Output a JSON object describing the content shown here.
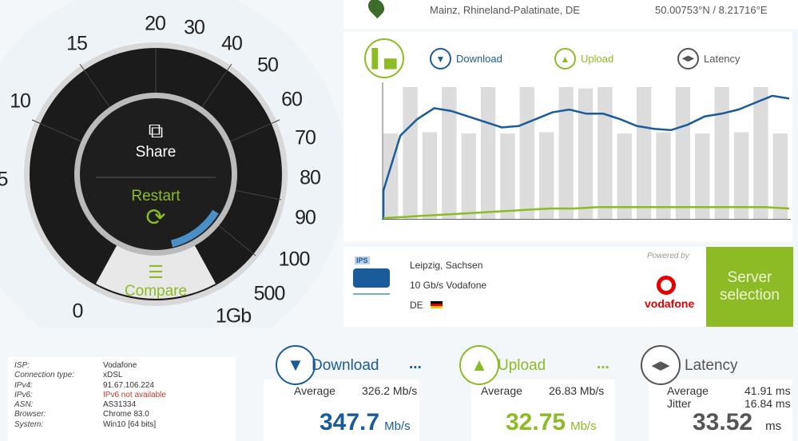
{
  "location": {
    "city": "Mainz, Rhineland-Palatinate, DE",
    "coords": "50.00753°N / 8.21716°E"
  },
  "gauge": {
    "labels": [
      "0",
      "5",
      "10",
      "15",
      "20",
      "30",
      "40",
      "50",
      "60",
      "70",
      "80",
      "90",
      "100",
      "500",
      "1Gb"
    ],
    "share": "Share",
    "restart": "Restart",
    "compare": "Compare",
    "progress_percent": 15
  },
  "legend": {
    "download": "Download",
    "upload": "Upload",
    "latency": "Latency"
  },
  "chart_data": {
    "type": "line",
    "series": [
      {
        "name": "Download",
        "values": [
          20,
          60,
          72,
          80,
          78,
          74,
          70,
          66,
          67,
          72,
          77,
          79,
          76,
          76,
          72,
          67,
          65,
          64,
          68,
          74,
          76,
          79,
          84,
          89,
          87
        ]
      },
      {
        "name": "Upload",
        "values": [
          0,
          1,
          2,
          3,
          4,
          5,
          6,
          7,
          7,
          8,
          8,
          8,
          8,
          8,
          8,
          8,
          8,
          7
        ]
      }
    ],
    "bars": [
      0.65,
      1,
      0.66,
      1,
      0.65,
      1,
      0.65,
      1,
      0.66,
      1,
      0.99,
      1,
      0.65,
      1,
      0.66,
      1,
      0.65,
      1,
      0.66,
      1,
      0.65
    ]
  },
  "server": {
    "city": "Leipzig, Sachsen",
    "provider": "10 Gb/s Vodafone",
    "country": "DE",
    "badge": "IPS",
    "powered_by": "Powered by",
    "brand": "vodafone",
    "button": "Server selection"
  },
  "info": [
    {
      "k": "ISP:",
      "v": "Vodafone"
    },
    {
      "k": "Connection type:",
      "v": "xDSL"
    },
    {
      "k": "IPv4:",
      "v": "91.67.106.224"
    },
    {
      "k": "IPv6:",
      "v": "IPv6 not available",
      "warn": true
    },
    {
      "k": "ASN:",
      "v": "AS31334"
    },
    {
      "k": "Browser:",
      "v": "Chrome 83.0"
    },
    {
      "k": "System:",
      "v": "Win10 [64 bits]"
    }
  ],
  "results": {
    "download": {
      "title": "Download",
      "more": "...",
      "avg_label": "Average",
      "avg": "326.2 Mb/s",
      "value": "347.7",
      "unit": "Mb/s"
    },
    "upload": {
      "title": "Upload",
      "more": "...",
      "avg_label": "Average",
      "avg": "26.83 Mb/s",
      "value": "32.75",
      "unit": "Mb/s"
    },
    "latency": {
      "title": "Latency",
      "avg_label": "Average",
      "avg": "41.91 ms",
      "jitter_label": "Jitter",
      "jitter": "16.84 ms",
      "value": "33.52",
      "unit": "ms"
    }
  },
  "colors": {
    "blue": "#1a5c9a",
    "green": "#8dbb25",
    "gray": "#555"
  }
}
